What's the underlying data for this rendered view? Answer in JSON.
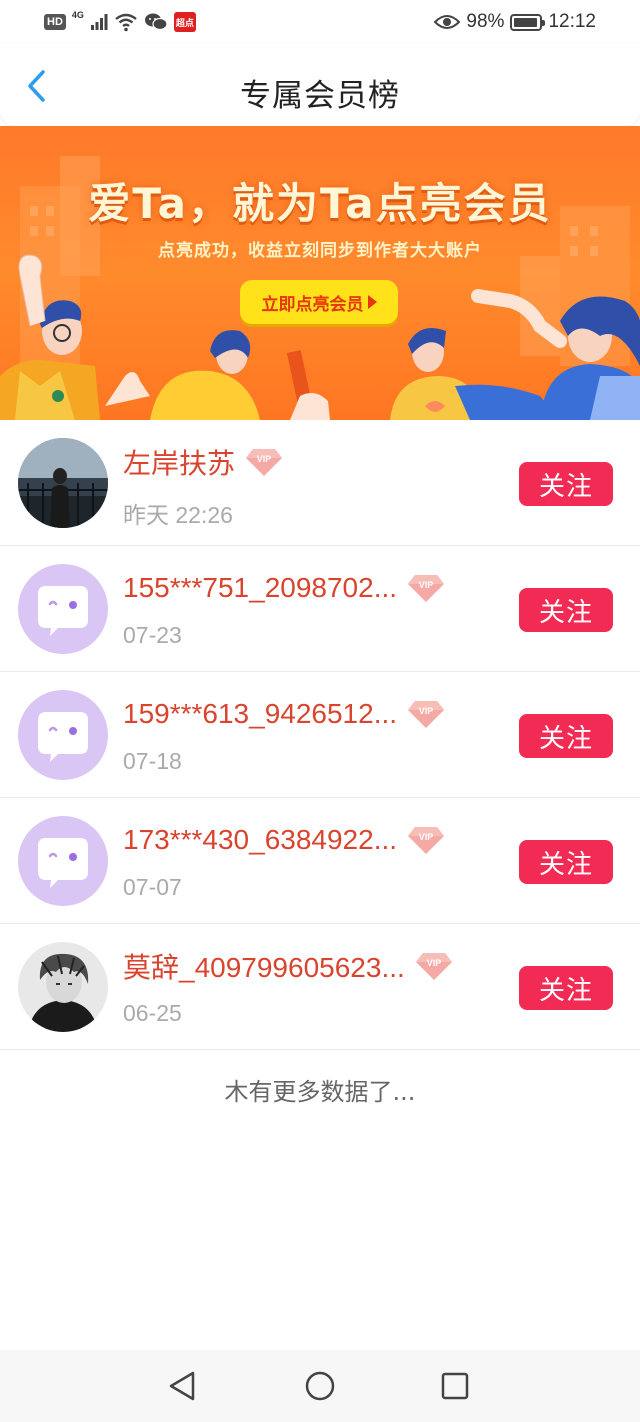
{
  "status_bar": {
    "hd_label": "HD",
    "network_label": "4G",
    "app_icon_label": "超点",
    "battery_percent": "98%",
    "time": "12:12"
  },
  "header": {
    "title": "专属会员榜"
  },
  "banner": {
    "title": "爱Ta，就为Ta点亮会员",
    "subtitle": "点亮成功，收益立刻同步到作者大大账户",
    "cta_label": "立即点亮会员"
  },
  "members": [
    {
      "name": "左岸扶苏",
      "date": "昨天 22:26",
      "follow_label": "关注",
      "avatar": "photo-night"
    },
    {
      "name": "155***751_2098702...",
      "date": "07-23",
      "follow_label": "关注",
      "avatar": "default"
    },
    {
      "name": "159***613_9426512...",
      "date": "07-18",
      "follow_label": "关注",
      "avatar": "default"
    },
    {
      "name": "173***430_6384922...",
      "date": "07-07",
      "follow_label": "关注",
      "avatar": "default"
    },
    {
      "name": "莫辞_409799605623...",
      "date": "06-25",
      "follow_label": "关注",
      "avatar": "photo-sketch"
    }
  ],
  "footer_text": "木有更多数据了...",
  "colors": {
    "accent_blue": "#2b9cf0",
    "follow_button": "#f22b55",
    "name_text": "#d9442f",
    "banner_orange": "#ff7a2a",
    "cta_yellow": "#ffe21a"
  }
}
